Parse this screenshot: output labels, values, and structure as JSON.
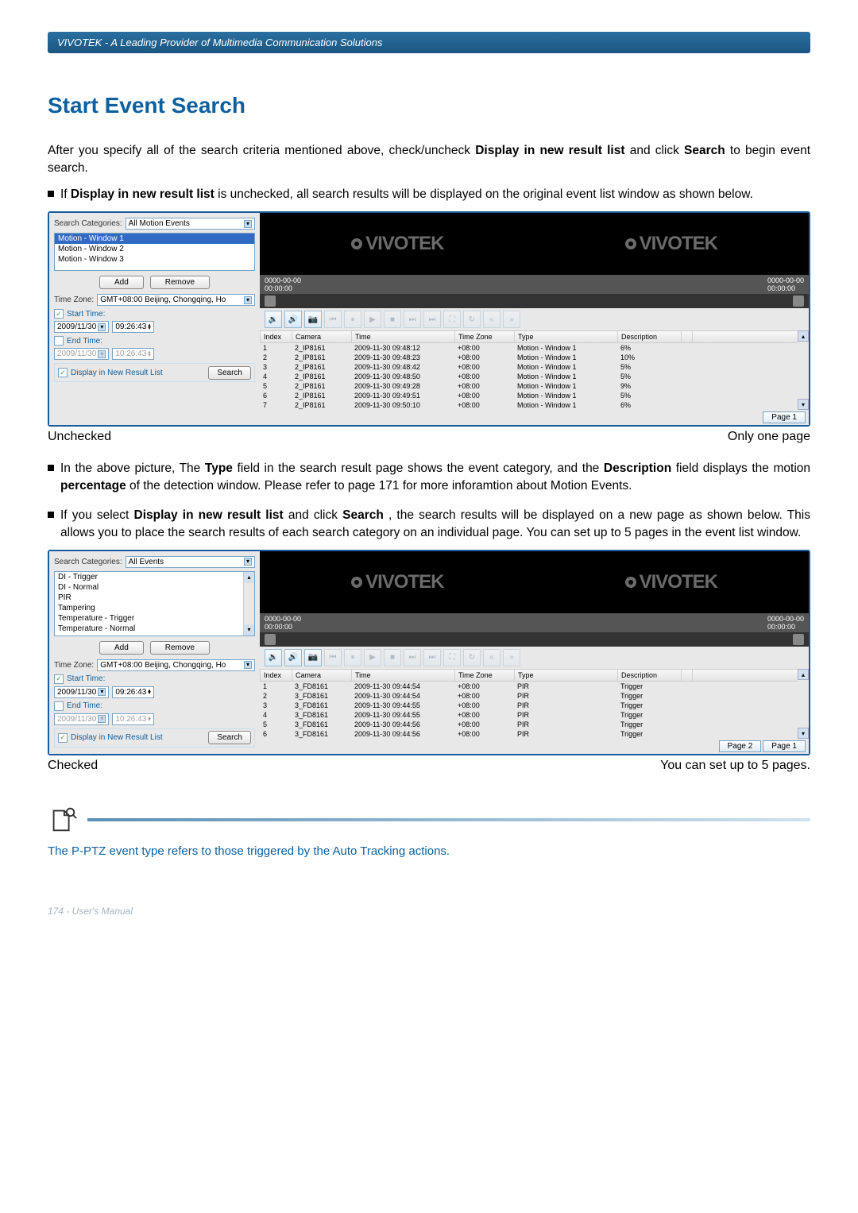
{
  "header": {
    "breadcrumb": "VIVOTEK - A Leading Provider of Multimedia Communication Solutions"
  },
  "section_title": "Start Event Search",
  "intro": {
    "p1_a": "After you specify all of the search criteria mentioned above, check/uncheck ",
    "p1_b": "Display in new result list",
    "p1_c": " and click ",
    "p1_d": "Search",
    "p1_e": " to begin event search."
  },
  "bullet1": {
    "a": "If ",
    "b": "Display in new result list",
    "c": " is unchecked, all search results will be displayed on the original event list window as shown below."
  },
  "caption1": {
    "left": "Unchecked",
    "right": "Only one page"
  },
  "bullet2": {
    "a": "In the above picture, The ",
    "b": "Type",
    "c": " field in the search result page shows the event category, and the ",
    "d": "Description",
    "e": " field displays the motion ",
    "f": "percentage",
    "g": " of the detection window. Please refer to page 171 for more inforamtion about Motion Events."
  },
  "bullet3": {
    "a": "If you select ",
    "b": "Display in new result list",
    "c": " and click ",
    "d": "Search",
    "e": ", the search results will be displayed on a new page as shown below. This allows you to place the search results of each search category on an individual page. You can set up to 5 pages in the event list window."
  },
  "caption2": {
    "left": "Checked",
    "right": "You can set up to 5 pages."
  },
  "note": "The P-PTZ event type refers to those triggered by the Auto Tracking actions.",
  "footer": "174 - User's Manual",
  "shot1": {
    "search_categories_label": "Search Categories:",
    "search_categories_value": "All Motion Events",
    "list_items": [
      "Motion - Window 1",
      "Motion - Window 2",
      "Motion - Window 3"
    ],
    "list_selected_index": 0,
    "add": "Add",
    "remove": "Remove",
    "tz_label": "Time Zone:",
    "tz_value": "GMT+08:00 Beijing, Chongqing, Ho",
    "start_label": "Start Time:",
    "start_date": "2009/11/30",
    "start_time": "09:26:43",
    "end_label": "End Time:",
    "end_date": "2009/11/30",
    "end_time": "10:26:43",
    "display_label": "Display in New Result List",
    "search_btn": "Search",
    "timeline_left": "0000-00-00\n00:00:00",
    "timeline_right": "0000-00-00\n00:00:00",
    "logo": "VIVOTEK",
    "columns": [
      "Index",
      "Camera",
      "Time",
      "Time Zone",
      "Type",
      "Description"
    ],
    "rows": [
      {
        "index": "1",
        "camera": "2_IP8161",
        "time": "2009-11-30 09:48:12",
        "tz": "+08:00",
        "type": "Motion - Window 1",
        "desc": "6%"
      },
      {
        "index": "2",
        "camera": "2_IP8161",
        "time": "2009-11-30 09:48:23",
        "tz": "+08:00",
        "type": "Motion - Window 1",
        "desc": "10%"
      },
      {
        "index": "3",
        "camera": "2_IP8161",
        "time": "2009-11-30 09:48:42",
        "tz": "+08:00",
        "type": "Motion - Window 1",
        "desc": "5%"
      },
      {
        "index": "4",
        "camera": "2_IP8161",
        "time": "2009-11-30 09:48:50",
        "tz": "+08:00",
        "type": "Motion - Window 1",
        "desc": "5%"
      },
      {
        "index": "5",
        "camera": "2_IP8161",
        "time": "2009-11-30 09:49:28",
        "tz": "+08:00",
        "type": "Motion - Window 1",
        "desc": "9%"
      },
      {
        "index": "6",
        "camera": "2_IP8161",
        "time": "2009-11-30 09:49:51",
        "tz": "+08:00",
        "type": "Motion - Window 1",
        "desc": "5%"
      },
      {
        "index": "7",
        "camera": "2_IP8161",
        "time": "2009-11-30 09:50:10",
        "tz": "+08:00",
        "type": "Motion - Window 1",
        "desc": "6%"
      }
    ],
    "pages": [
      "Page 1"
    ]
  },
  "shot2": {
    "search_categories_value": "All Events",
    "list_items": [
      "DI - Trigger",
      "DI - Normal",
      "PIR",
      "Tampering",
      "Temperature - Trigger",
      "Temperature - Normal"
    ],
    "rows": [
      {
        "index": "1",
        "camera": "3_FD8161",
        "time": "2009-11-30 09:44:54",
        "tz": "+08:00",
        "type": "PIR",
        "desc": "Trigger"
      },
      {
        "index": "2",
        "camera": "3_FD8161",
        "time": "2009-11-30 09:44:54",
        "tz": "+08:00",
        "type": "PIR",
        "desc": "Trigger"
      },
      {
        "index": "3",
        "camera": "3_FD8161",
        "time": "2009-11-30 09:44:55",
        "tz": "+08:00",
        "type": "PIR",
        "desc": "Trigger"
      },
      {
        "index": "4",
        "camera": "3_FD8161",
        "time": "2009-11-30 09:44:55",
        "tz": "+08:00",
        "type": "PIR",
        "desc": "Trigger"
      },
      {
        "index": "5",
        "camera": "3_FD8161",
        "time": "2009-11-30 09:44:56",
        "tz": "+08:00",
        "type": "PIR",
        "desc": "Trigger"
      },
      {
        "index": "6",
        "camera": "3_FD8161",
        "time": "2009-11-30 09:44:56",
        "tz": "+08:00",
        "type": "PIR",
        "desc": "Trigger"
      }
    ],
    "pages": [
      "Page 2",
      "Page 1"
    ]
  }
}
